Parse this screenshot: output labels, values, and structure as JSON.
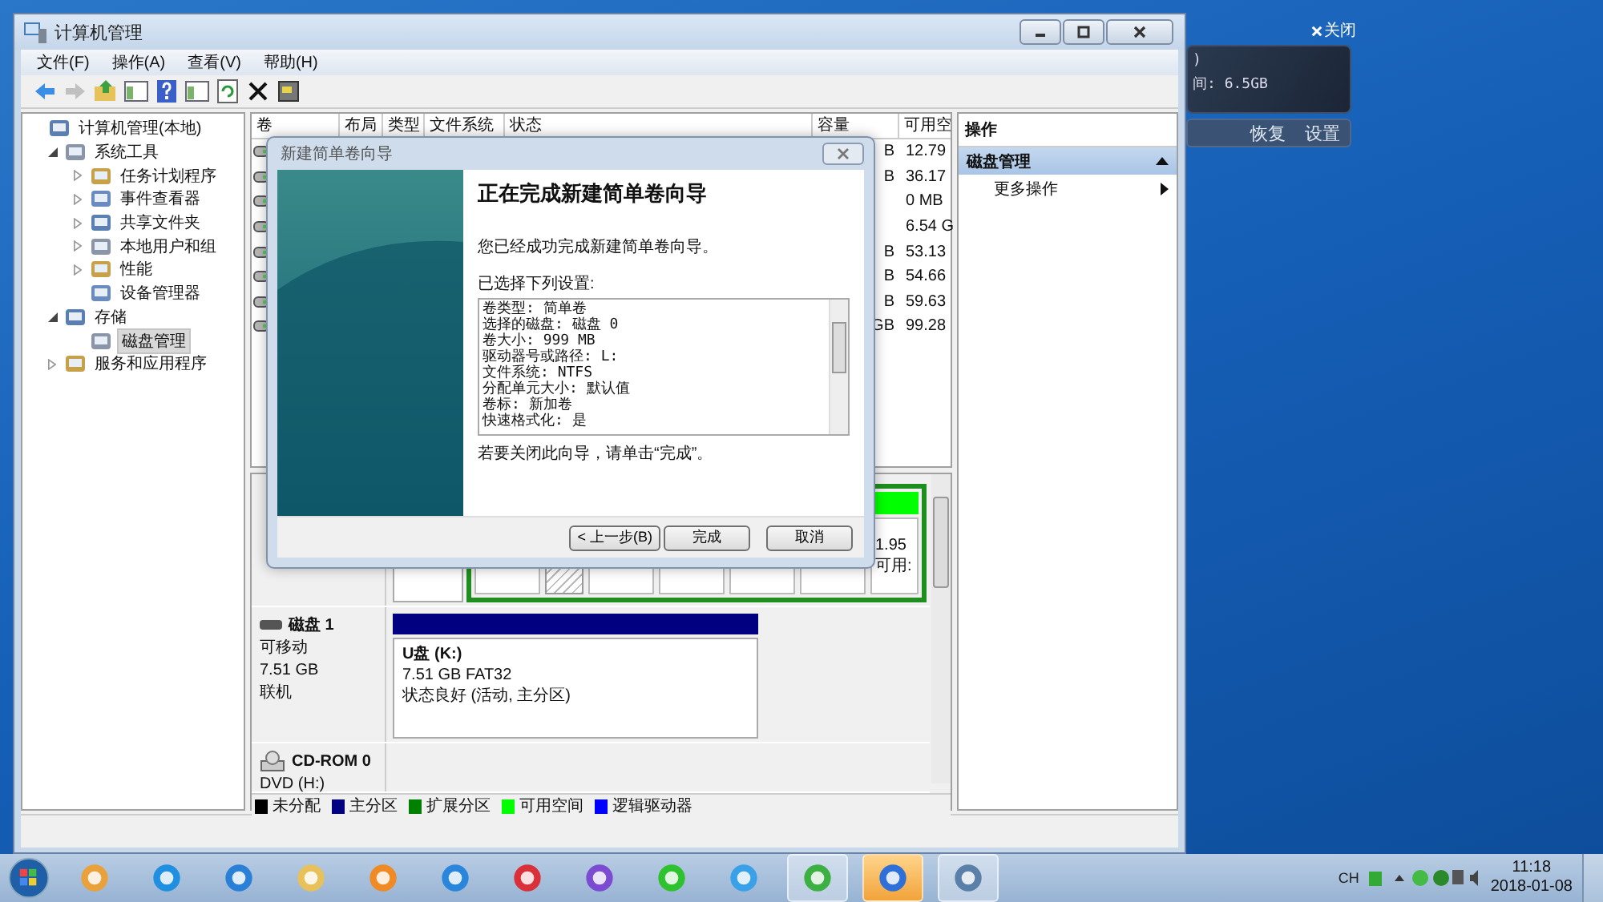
{
  "window": {
    "title": "计算机管理"
  },
  "menu": [
    "文件(F)",
    "操作(A)",
    "查看(V)",
    "帮助(H)"
  ],
  "toolbar": [
    {
      "kind": "back",
      "disabled": false
    },
    {
      "kind": "forward",
      "disabled": true
    },
    {
      "kind": "up",
      "disabled": false
    },
    {
      "kind": "panel",
      "disabled": false
    },
    {
      "kind": "help",
      "disabled": false
    },
    {
      "kind": "panel",
      "disabled": false
    },
    {
      "kind": "refresh",
      "disabled": false
    },
    {
      "kind": "delete",
      "disabled": false
    },
    {
      "kind": "properties",
      "disabled": false
    }
  ],
  "tree": [
    {
      "label": "计算机管理(本地)",
      "selected": false,
      "children": [
        {
          "label": "系统工具",
          "kind": "branch",
          "expanded": true,
          "selected": false,
          "children": [
            {
              "label": "任务计划程序",
              "kind": "branch",
              "expanded": false,
              "selected": false
            },
            {
              "label": "事件查看器",
              "kind": "branch",
              "expanded": false,
              "selected": false
            },
            {
              "label": "共享文件夹",
              "kind": "branch",
              "expanded": false,
              "selected": false
            },
            {
              "label": "本地用户和组",
              "kind": "branch",
              "expanded": false,
              "selected": false
            },
            {
              "label": "性能",
              "kind": "branch",
              "expanded": false,
              "selected": false
            },
            {
              "label": "设备管理器",
              "kind": "leaf",
              "selected": false
            }
          ]
        },
        {
          "label": "存储",
          "kind": "branch",
          "expanded": true,
          "selected": false,
          "children": [
            {
              "label": "磁盘管理",
              "kind": "leaf",
              "selected": true
            }
          ]
        },
        {
          "label": "服务和应用程序",
          "kind": "branch",
          "expanded": false,
          "selected": false
        }
      ]
    }
  ],
  "table": {
    "columns": [
      "卷",
      "布局",
      "类型",
      "文件系统",
      "状态",
      "容量",
      "可用空"
    ],
    "rows": [
      {
        "capacity": "B",
        "free": "12.79"
      },
      {
        "capacity": "B",
        "free": "36.17"
      },
      {
        "capacity": "",
        "free": "0 MB"
      },
      {
        "capacity": "",
        "free": "6.54 G"
      },
      {
        "capacity": "B",
        "free": "53.13"
      },
      {
        "capacity": "B",
        "free": "54.66"
      },
      {
        "capacity": "B",
        "free": "59.63"
      },
      {
        "capacity": "GB",
        "free": "99.28"
      }
    ]
  },
  "disks": [
    {
      "kind": "basic",
      "partitions": [
        {
          "kind": "plain"
        }
      ],
      "extended": [
        {
          "kind": "plain"
        },
        {
          "kind": "hatched"
        },
        {
          "kind": "plain"
        },
        {
          "kind": "plain"
        },
        {
          "kind": "plain"
        },
        {
          "kind": "plain"
        },
        {
          "kind": "free",
          "lines": [
            "1.95",
            "可用:"
          ]
        }
      ]
    },
    {
      "kind": "removable",
      "name": "磁盘 1",
      "lines": [
        "可移动",
        "7.51 GB",
        "联机"
      ],
      "partitions": [
        {
          "kind": "primary",
          "name": "U盘  (K:)",
          "lines": [
            "7.51 GB FAT32",
            "状态良好 (活动, 主分区)"
          ]
        }
      ]
    },
    {
      "kind": "cdrom",
      "name": "CD-ROM 0",
      "lines": [
        "DVD (H:)"
      ]
    }
  ],
  "legend": [
    {
      "label": "未分配",
      "color": "#000000"
    },
    {
      "label": "主分区",
      "color": "#000080"
    },
    {
      "label": "扩展分区",
      "color": "#008000"
    },
    {
      "label": "可用空间",
      "color": "#00ff00"
    },
    {
      "label": "逻辑驱动器",
      "color": "#0000ff"
    }
  ],
  "actions": {
    "title": "操作",
    "items": [
      {
        "label": "磁盘管理",
        "kind": "section",
        "selected": true
      },
      {
        "label": "更多操作",
        "kind": "submenu",
        "selected": false
      }
    ]
  },
  "dialog": {
    "title": "新建简单卷向导",
    "heading": "正在完成新建简单卷向导",
    "message": "您已经成功完成新建简单卷向导。",
    "settings_label": "已选择下列设置:",
    "settings": [
      "卷类型: 简单卷",
      "选择的磁盘: 磁盘 0",
      "卷大小: 999 MB",
      "驱动器号或路径: L:",
      "文件系统: NTFS",
      "分配单元大小: 默认值",
      "卷标: 新加卷",
      "快速格式化: 是"
    ],
    "hint": "若要关闭此向导，请单击“完成”。",
    "buttons": [
      "< 上一步(B)",
      "完成",
      "取消"
    ]
  },
  "widget": {
    "close": "关闭",
    "lines": [
      ")",
      "间: 6.5GB"
    ],
    "buttons": [
      "恢复",
      "设置"
    ]
  },
  "taskbar": {
    "apps": [
      {
        "open": false,
        "selected": false
      },
      {
        "open": false,
        "selected": false
      },
      {
        "open": false,
        "selected": false
      },
      {
        "open": false,
        "selected": false
      },
      {
        "open": false,
        "selected": false
      },
      {
        "open": false,
        "selected": false
      },
      {
        "open": false,
        "selected": false
      },
      {
        "open": false,
        "selected": false
      },
      {
        "open": false,
        "selected": false
      },
      {
        "open": false,
        "selected": false
      },
      {
        "open": true,
        "selected": false
      },
      {
        "open": true,
        "selected": true
      },
      {
        "open": true,
        "selected": false
      }
    ],
    "language": "CH",
    "time": "11:18",
    "date": "2018-01-08"
  }
}
